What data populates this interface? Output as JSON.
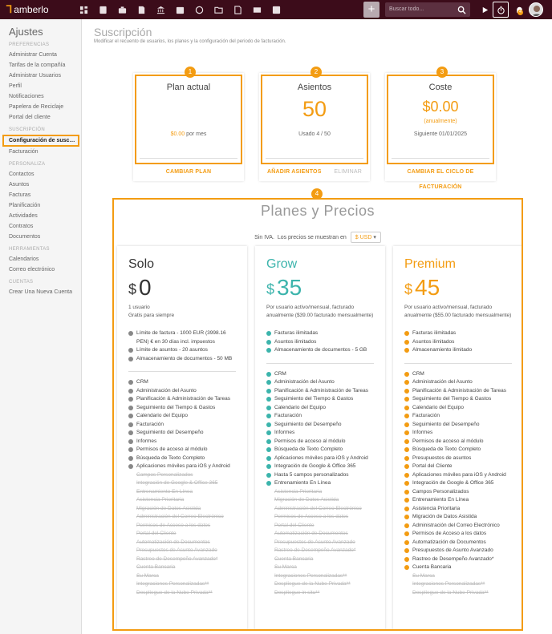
{
  "app": {
    "brand": "amberlo",
    "search_placeholder": "Buscar todo..."
  },
  "colors": {
    "accent": "#f39c12",
    "topbar": "#3c0c1a",
    "grow": "#3cb4ac",
    "premium": "#f39c12",
    "solo": "#888888"
  },
  "topbar": {
    "nav_icons": [
      "dashboard-icon",
      "contacts-icon",
      "matters-icon",
      "documents-icon",
      "billing-icon",
      "calendar-icon",
      "history-icon",
      "folder-icon",
      "invoice-icon",
      "mail-icon",
      "reports-icon"
    ],
    "notification_count": "4"
  },
  "sidebar": {
    "title": "Ajustes",
    "sections": [
      {
        "label": "PREFERENCIAS",
        "items": [
          "Administrar Cuenta",
          "Tarifas de la compañía",
          "Administrar Usuarios",
          "Perfil",
          "Notificaciones",
          "Papelera de Reciclaje",
          "Portal del cliente"
        ]
      },
      {
        "label": "SUSCRIPCIÓN",
        "items": [
          "Configuración de suscripc...",
          "Facturación"
        ]
      },
      {
        "label": "PERSONALIZA",
        "items": [
          "Contactos",
          "Asuntos",
          "Facturas",
          "Planificación",
          "Actividades",
          "Contratos",
          "Documentos"
        ]
      },
      {
        "label": "HERRAMIENTAS",
        "items": [
          "Calendarios",
          "Correo electrónico"
        ]
      },
      {
        "label": "CUENTAS",
        "items": [
          "Crear Una Nueva Cuenta"
        ]
      }
    ]
  },
  "page": {
    "title": "Suscripción",
    "subtitle": "Modificar el recuento de usuarios, los planes y la configuración del periodo de facturación."
  },
  "cards": {
    "plan": {
      "num": "1",
      "title": "Plan actual",
      "price": "$0.00",
      "per": "por mes",
      "action": "CAMBIAR PLAN"
    },
    "seats": {
      "num": "2",
      "title": "Asientos",
      "value": "50",
      "usage": "Usado 4 / 50",
      "action": "AÑADIR ASIENTOS",
      "action2": "ELIMINAR"
    },
    "cost": {
      "num": "3",
      "title": "Coste",
      "value": "$0.00",
      "period": "(anualmente)",
      "next": "Siguiente 01/01/2025",
      "action": "CAMBIAR EL CICLO DE FACTURACIÓN"
    }
  },
  "pricing": {
    "num": "4",
    "title": "Planes y Precios",
    "tax_note": "Sin IVA.",
    "currency_label": "Los precios se muestran en",
    "currency": "$ USD",
    "plans": [
      {
        "name": "Solo",
        "currency": "$",
        "amount": "0",
        "desc": "1 usuario",
        "desc2": "Gratis para siempre",
        "limits": [
          "Límite de factura - 1000 EUR (3998.16 PEN) € en 30 días incl. impuestos",
          "Límite de asuntos - 20 asuntos",
          "Almacenamiento de documentos - 50 MB"
        ],
        "features": [
          "CRM",
          "Administración del Asunto",
          "Planificación & Administración de Tareas",
          "Seguimiento del Tiempo & Gastos",
          "Calendario del Equipo",
          "Facturación",
          "Seguimiento del Desempeño",
          "Informes",
          "Permisos de acceso al módulo",
          "Búsqueda de Texto Completo",
          "Aplicaciones móviles para iOS y Android"
        ],
        "excluded": [
          "Campos Personalizados",
          "Integración de Google & Office 365",
          "Entrenamiento En Línea",
          "Asistencia Prioritaria",
          "Migración de Datos Asistida",
          "Administración del Correo Electrónico",
          "Permisos de Acceso a los datos",
          "Portal del Cliente",
          "Automatización de Documentos",
          "Presupuestos de Asunto Avanzado",
          "Rastreo de Desempeño Avanzado*",
          "Cuenta Bancaria",
          "Su Marca",
          "Integraciones Personalizadas**",
          "Despliegue de la Nube Privada**"
        ]
      },
      {
        "name": "Grow",
        "currency": "$",
        "amount": "35",
        "desc": "Por usuario activo/mensual, facturado anualmente ($39.00 facturado mensualmente)",
        "desc2": "",
        "limits": [
          "Facturas ilimitadas",
          "Asuntos ilimitados",
          "Almacenamiento de documentos - 5 GB"
        ],
        "features": [
          "CRM",
          "Administración del Asunto",
          "Planificación & Administración de Tareas",
          "Seguimiento del Tiempo & Gastos",
          "Calendario del Equipo",
          "Facturación",
          "Seguimiento del Desempeño",
          "Informes",
          "Permisos de acceso al módulo",
          "Búsqueda de Texto Completo",
          "Aplicaciones móviles para iOS y Android",
          "Integración de Google & Office 365",
          "Hasta 5 campos personalizados",
          "Entrenamiento En Línea"
        ],
        "excluded": [
          "Asistencia Prioritaria",
          "Migración de Datos Asistida",
          "Administración del Correo Electrónico",
          "Permisos de Acceso a los datos",
          "Portal del Cliente",
          "Automatización de Documentos",
          "Presupuestos de Asunto Avanzado",
          "Rastreo de Desempeño Avanzado*",
          "Cuenta Bancaria",
          "Su Marca",
          "Integraciones Personalizadas**",
          "Despliegue de la Nube Privada**",
          "Despliegue in situ**"
        ]
      },
      {
        "name": "Premium",
        "currency": "$",
        "amount": "45",
        "desc": "Por usuario activo/mensual, facturado anualmente ($55.00 facturado mensualmente)",
        "desc2": "",
        "limits": [
          "Facturas ilimitadas",
          "Asuntos ilimitados",
          "Almacenamiento ilimitado"
        ],
        "features": [
          "CRM",
          "Administración del Asunto",
          "Planificación & Administración de Tareas",
          "Seguimiento del Tiempo & Gastos",
          "Calendario del Equipo",
          "Facturación",
          "Seguimiento del Desempeño",
          "Informes",
          "Permisos de acceso al módulo",
          "Búsqueda de Texto Completo",
          "Presupuestos de asuntos",
          "Portal del Cliente",
          "Aplicaciones móviles para iOS y Android",
          "Integración de Google & Office 365",
          "Campos Personalizados",
          "Entrenamiento En Línea",
          "Asistencia Prioritaria",
          "Migración de Datos Asistida",
          "Administración del Correo Electrónico",
          "Permisos de Acceso a los datos",
          "Automatización de Documentos",
          "Presupuestos de Asunto Avanzado",
          "Rastreo de Desempeño Avanzado*",
          "Cuenta Bancaria"
        ],
        "excluded": [
          "Su Marca",
          "Integraciones Personalizadas**",
          "Despliegue de la Nube Privada**"
        ]
      }
    ]
  }
}
